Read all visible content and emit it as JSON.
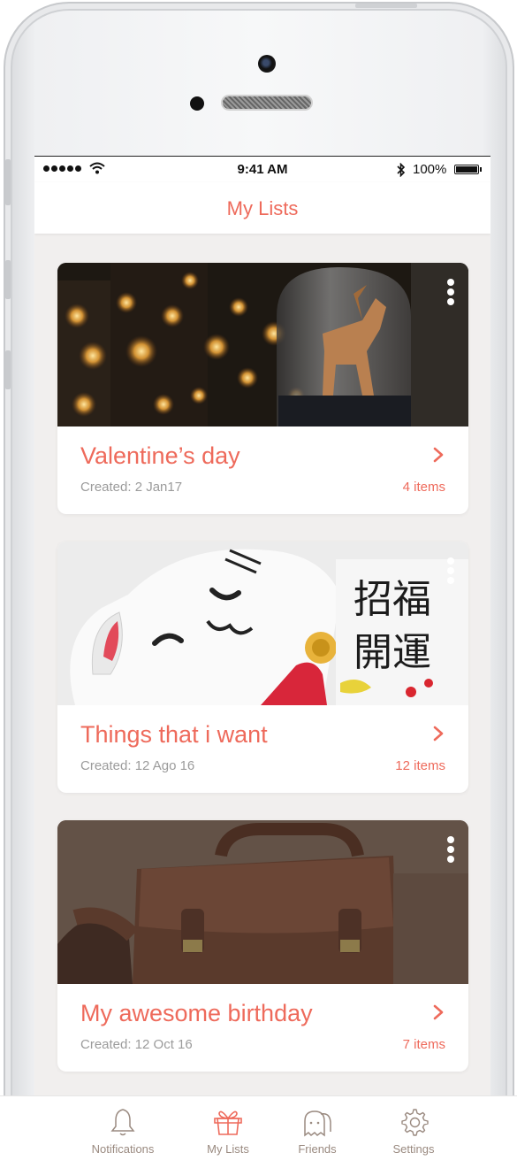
{
  "status_bar": {
    "time": "9:41 AM",
    "battery": "100%"
  },
  "header": {
    "title": "My Lists"
  },
  "lists": [
    {
      "title": "Valentine’s day",
      "created": "Created: 2 Jan17",
      "count": "4 items",
      "image": "candles-and-origami-deer-photo"
    },
    {
      "title": "Things that i want",
      "created": "Created: 12 Ago 16",
      "count": "12 items",
      "image": "lucky-cat-figurine-photo"
    },
    {
      "title": "My awesome birthday",
      "created": "Created: 12 Oct 16",
      "count": "7 items",
      "image": "leather-messenger-bag-photo"
    }
  ],
  "tabs": [
    {
      "label": "Notifications",
      "icon": "bell-icon"
    },
    {
      "label": "My Lists",
      "icon": "gift-icon",
      "active": true
    },
    {
      "label": "Friends",
      "icon": "friends-icon"
    },
    {
      "label": "Settings",
      "icon": "gear-icon"
    }
  ],
  "colors": {
    "accent": "#ee6a5b",
    "muted_text": "#9b9b9b",
    "screen_bg": "#f1efee",
    "tab_label": "#9a8a80"
  }
}
